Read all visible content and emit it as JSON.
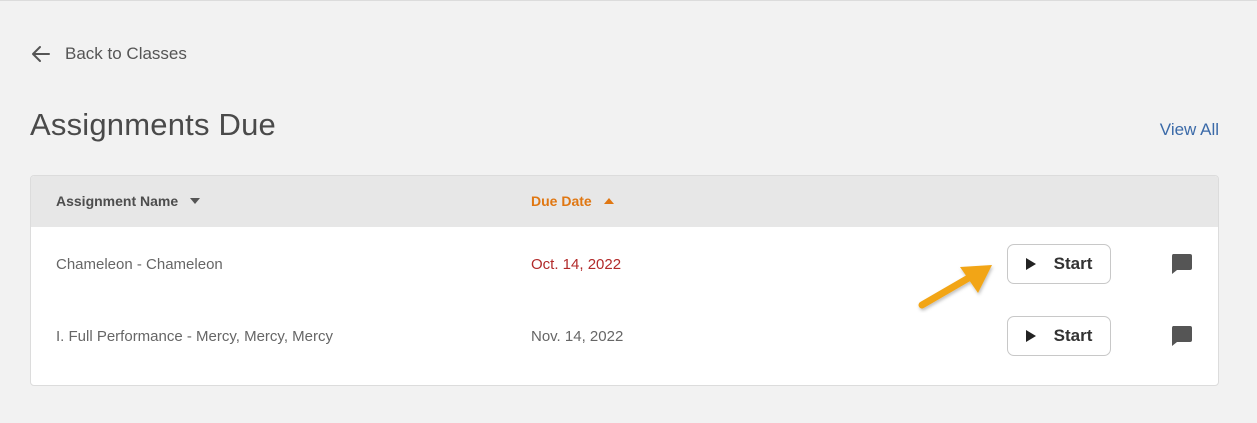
{
  "nav": {
    "back_label": "Back to Classes"
  },
  "page": {
    "title": "Assignments Due",
    "view_all_label": "View All"
  },
  "table": {
    "columns": [
      {
        "label": "Assignment Name",
        "sort": "desc"
      },
      {
        "label": "Due Date",
        "sort": "asc",
        "active": true
      }
    ],
    "rows": [
      {
        "name": "Chameleon - Chameleon",
        "due": "Oct. 14, 2022",
        "overdue": true,
        "action_label": "Start"
      },
      {
        "name": "I. Full Performance - Mercy, Mercy, Mercy",
        "due": "Nov. 14, 2022",
        "overdue": false,
        "action_label": "Start"
      }
    ]
  },
  "colors": {
    "background": "#f2f2f2",
    "accent_sort": "#e07712",
    "overdue_date": "#b22a2a",
    "link": "#3b6aa8",
    "annotation_arrow": "#f2a516"
  },
  "icons": [
    "arrow-left-icon",
    "caret-down-icon",
    "caret-up-icon",
    "play-icon",
    "comment-icon",
    "annotation-arrow"
  ]
}
